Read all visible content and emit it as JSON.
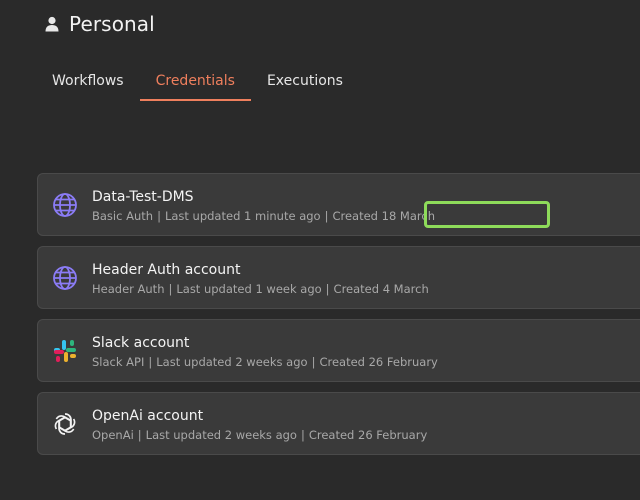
{
  "header": {
    "title": "Personal",
    "icon": "user-icon"
  },
  "tabs": [
    {
      "label": "Workflows",
      "active": false
    },
    {
      "label": "Credentials",
      "active": true
    },
    {
      "label": "Executions",
      "active": false
    }
  ],
  "credentials": [
    {
      "name": "Data-Test-DMS",
      "type": "Basic Auth",
      "updated": "Last updated 1 minute ago",
      "created": "Created 18 March",
      "icon": "globe-icon"
    },
    {
      "name": "Header Auth account",
      "type": "Header Auth",
      "updated": "Last updated 1 week ago",
      "created": "Created 4 March",
      "icon": "globe-icon"
    },
    {
      "name": "Slack account",
      "type": "Slack API",
      "updated": "Last updated 2 weeks ago",
      "created": "Created 26 February",
      "icon": "slack-icon"
    },
    {
      "name": "OpenAi account",
      "type": "OpenAi",
      "updated": "Last updated 2 weeks ago",
      "created": "Created 26 February",
      "icon": "openai-icon"
    }
  ],
  "colors": {
    "accent": "#ef7f5d",
    "highlight": "#8edb5a",
    "background": "#2a2a2a",
    "card": "#3a3a3a",
    "globe": "#8b7cf6"
  }
}
